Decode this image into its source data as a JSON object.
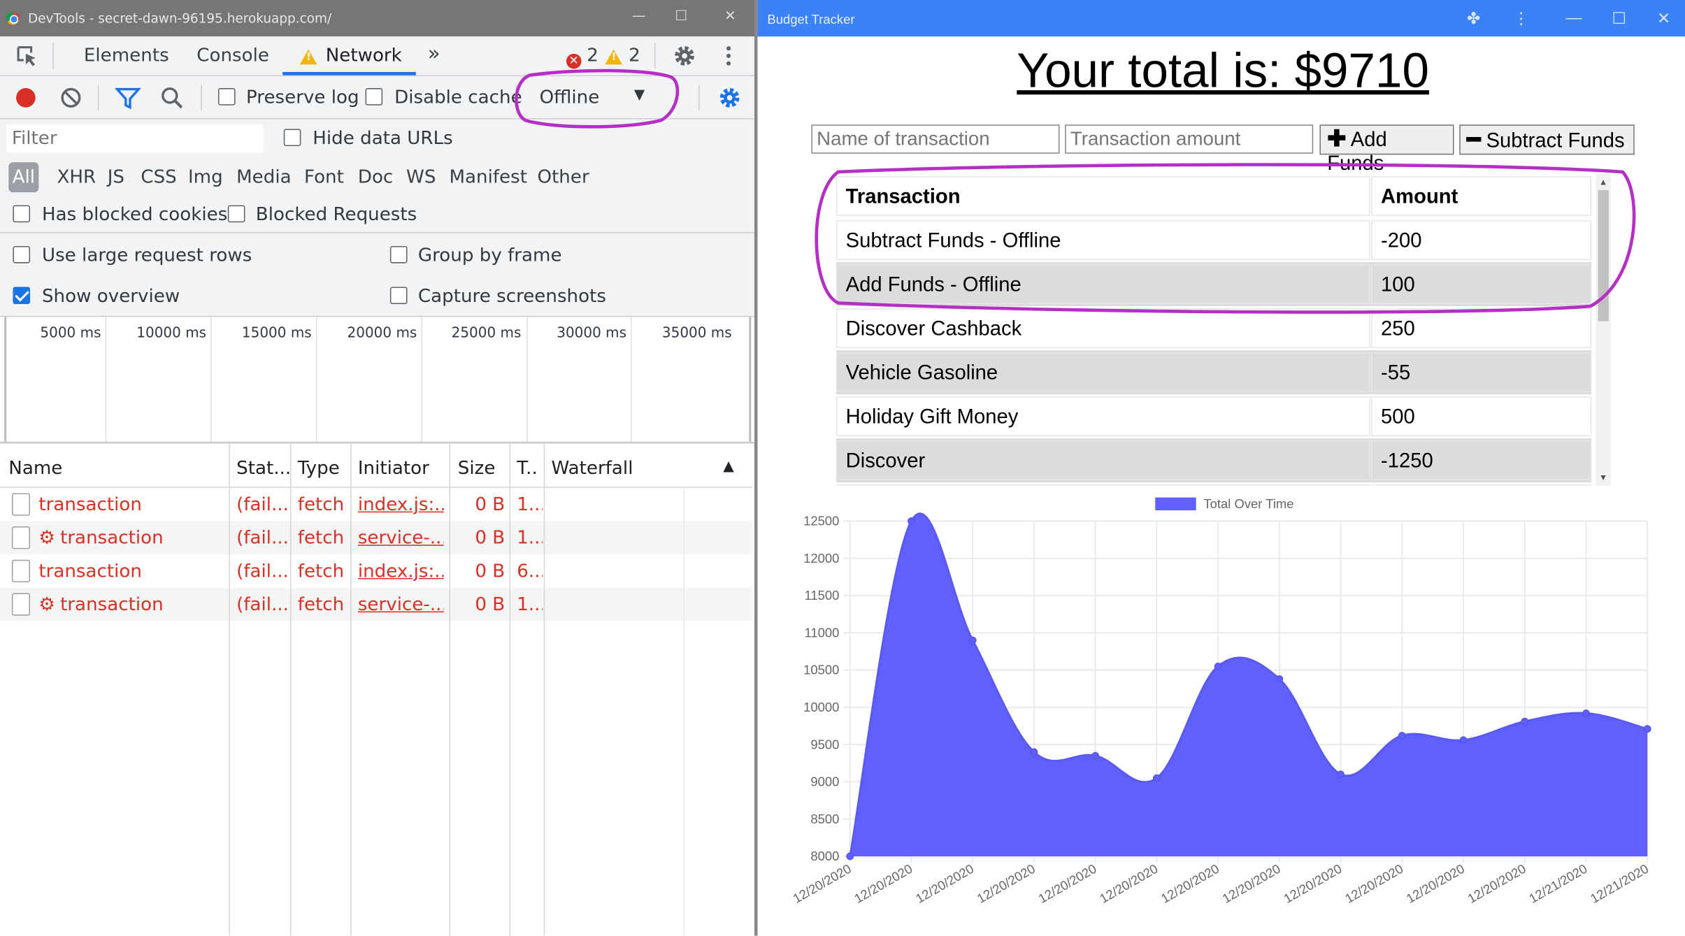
{
  "devtools": {
    "window_title": "DevTools - secret-dawn-96195.herokuapp.com/",
    "tabs": [
      "Elements",
      "Console",
      "Network"
    ],
    "more_tabs": "»",
    "error_count": "2",
    "warning_count": "2",
    "toolbar": {
      "preserve_log": "Preserve log",
      "disable_cache": "Disable cache",
      "throttling_value": "Offline"
    },
    "filter": {
      "placeholder": "Filter",
      "hide_data_urls": "Hide data URLs",
      "types": [
        "All",
        "XHR",
        "JS",
        "CSS",
        "Img",
        "Media",
        "Font",
        "Doc",
        "WS",
        "Manifest",
        "Other"
      ],
      "has_blocked_cookies": "Has blocked cookies",
      "blocked_requests": "Blocked Requests"
    },
    "settings": {
      "large_rows": "Use large request rows",
      "group_by_frame": "Group by frame",
      "show_overview": "Show overview",
      "capture_screenshots": "Capture screenshots"
    },
    "overview_ticks": [
      "5000 ms",
      "10000 ms",
      "15000 ms",
      "20000 ms",
      "25000 ms",
      "30000 ms",
      "35000 ms"
    ],
    "columns": [
      "Name",
      "Stat...",
      "Type",
      "Initiator",
      "Size",
      "T..",
      "Waterfall"
    ],
    "requests": [
      {
        "name": "transaction",
        "sw": false,
        "status": "(fail...",
        "type": "fetch",
        "initiator": "index.js:...",
        "size": "0 B",
        "time": "1..."
      },
      {
        "name": "transaction",
        "sw": true,
        "status": "(fail...",
        "type": "fetch",
        "initiator": "service-...",
        "size": "0 B",
        "time": "1..."
      },
      {
        "name": "transaction",
        "sw": false,
        "status": "(fail...",
        "type": "fetch",
        "initiator": "index.js:...",
        "size": "0 B",
        "time": "6..."
      },
      {
        "name": "transaction",
        "sw": true,
        "status": "(fail...",
        "type": "fetch",
        "initiator": "service-...",
        "size": "0 B",
        "time": "1..."
      }
    ]
  },
  "app": {
    "window_title": "Budget Tracker",
    "total_text": "Your total is: $9710",
    "name_placeholder": "Name of transaction",
    "amount_placeholder": "Transaction amount",
    "add_button": "Add Funds",
    "subtract_button": "Subtract Funds",
    "table_headers": [
      "Transaction",
      "Amount"
    ],
    "transactions": [
      {
        "name": "Subtract Funds - Offline",
        "amount": "-200"
      },
      {
        "name": "Add Funds - Offline",
        "amount": "100"
      },
      {
        "name": "Discover Cashback",
        "amount": "250"
      },
      {
        "name": "Vehicle Gasoline",
        "amount": "-55"
      },
      {
        "name": "Holiday Gift Money",
        "amount": "500"
      },
      {
        "name": "Discover",
        "amount": "-1250"
      }
    ],
    "colors": {
      "titlebar": "#3b82f6",
      "chart_fill": "#6060ff"
    }
  },
  "chart_data": {
    "type": "area",
    "legend": "Total Over Time",
    "legend_position": "top",
    "x": [
      "12/20/2020",
      "12/20/2020",
      "12/20/2020",
      "12/20/2020",
      "12/20/2020",
      "12/20/2020",
      "12/20/2020",
      "12/20/2020",
      "12/20/2020",
      "12/20/2020",
      "12/20/2020",
      "12/20/2020",
      "12/21/2020",
      "12/21/2020"
    ],
    "series": [
      {
        "name": "Total Over Time",
        "values": [
          8000,
          12500,
          10900,
          9400,
          9350,
          9050,
          10550,
          10380,
          9100,
          9620,
          9560,
          9810,
          9920,
          9710
        ]
      }
    ],
    "yticks": [
      8000,
      8500,
      9000,
      9500,
      10000,
      10500,
      11000,
      11500,
      12000,
      12500
    ],
    "ylim": [
      8000,
      12500
    ],
    "grid": true
  }
}
